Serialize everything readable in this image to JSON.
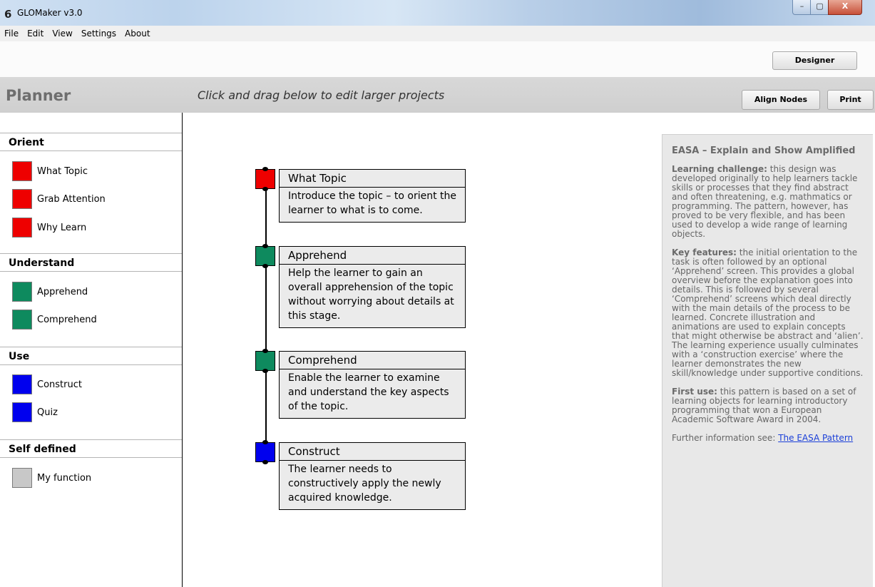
{
  "window": {
    "title": "GLOMaker v3.0",
    "min_glyph": "–",
    "max_glyph": "▢",
    "close_glyph": "X"
  },
  "menu": [
    "File",
    "Edit",
    "View",
    "Settings",
    "About"
  ],
  "toolbar": {
    "designer_label": "Designer"
  },
  "planner": {
    "title": "Planner",
    "hint": "Click and drag below to edit larger projects",
    "align_label": "Align Nodes",
    "print_label": "Print"
  },
  "palette": {
    "sections": [
      {
        "title": "Orient",
        "items": [
          {
            "label": "What Topic",
            "color": "#ee0000"
          },
          {
            "label": "Grab Attention",
            "color": "#ee0000"
          },
          {
            "label": "Why Learn",
            "color": "#ee0000"
          }
        ]
      },
      {
        "title": "Understand",
        "items": [
          {
            "label": "Apprehend",
            "color": "#0e8a5e"
          },
          {
            "label": "Comprehend",
            "color": "#0e8a5e"
          }
        ]
      },
      {
        "title": "Use",
        "items": [
          {
            "label": "Construct",
            "color": "#0000ee"
          },
          {
            "label": "Quiz",
            "color": "#0000ee"
          }
        ]
      },
      {
        "title": "Self defined",
        "items": [
          {
            "label": "My function",
            "color": "#c8c8c8"
          }
        ]
      }
    ]
  },
  "nodes": [
    {
      "title": "What Topic",
      "desc": "Introduce the topic – to orient the learner to what is to come.",
      "color": "#ee0000"
    },
    {
      "title": "Apprehend",
      "desc": "Help the learner to gain an overall apprehension of the topic without worrying about details at this stage.",
      "color": "#0e8a5e"
    },
    {
      "title": "Comprehend",
      "desc": "Enable the learner to examine and understand the key aspects of the topic.",
      "color": "#0e8a5e"
    },
    {
      "title": "Construct",
      "desc": "The learner needs to constructively apply the newly acquired knowledge.",
      "color": "#0000ee"
    }
  ],
  "info": {
    "heading": "EASA – Explain and Show Amplified",
    "challenge_label": "Learning challenge:",
    "challenge_text": " this design was developed originally to help learners tackle skills or processes that they find abstract and often threatening, e.g. mathmatics or programming. The pattern, however, has proved to be very flexible, and has been used to develop a wide range of learning objects.",
    "features_label": "Key features:",
    "features_text": " the initial orientation to the task is often followed by an optional ‘Apprehend’ screen. This provides a global overview before the explanation goes into details. This is followed by several ‘Comprehend’ screens which deal directly with the main details of the process to be learned. Concrete illustration and animations are used to explain concepts that might otherwise be abstract and ‘alien’. The learning experience usually culminates with a ‘construction exercise’ where the learner demonstrates the new skill/knowledge under supportive conditions.",
    "first_use_label": "First use:",
    "first_use_text": " this pattern is based on a set of learning objects for learning introductory programming that won a European Academic Software Award in 2004.",
    "further_text": "Further information see: ",
    "link_text": "The EASA Pattern"
  }
}
